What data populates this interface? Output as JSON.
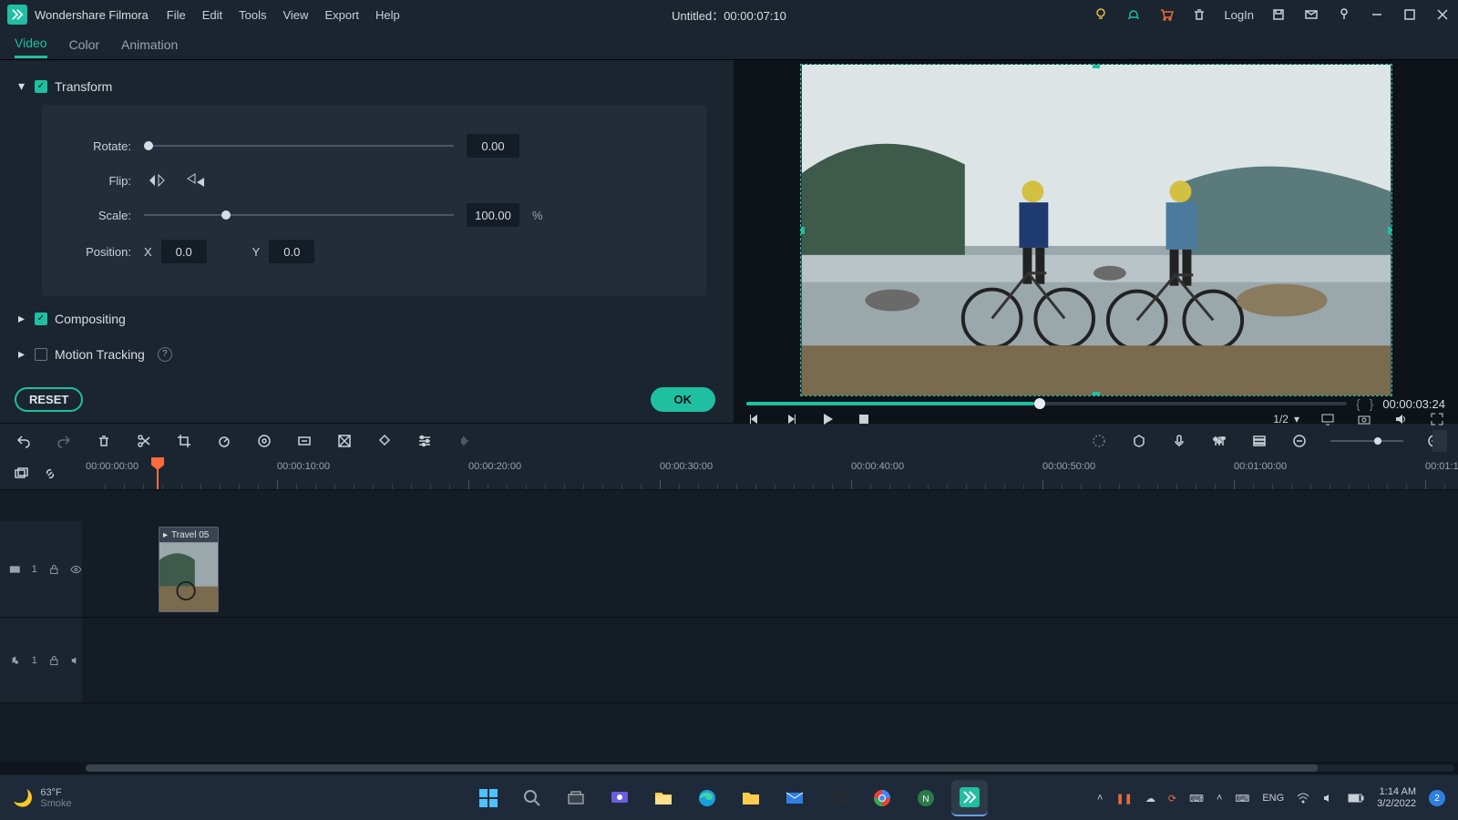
{
  "app_name": "Wondershare Filmora",
  "menu": [
    "File",
    "Edit",
    "Tools",
    "View",
    "Export",
    "Help"
  ],
  "title_center": "Untitled：00:00:07:10",
  "login_label": "LogIn",
  "tabs": [
    "Video",
    "Color",
    "Animation"
  ],
  "active_tab": "Video",
  "transform": {
    "label": "Transform",
    "rotate_label": "Rotate:",
    "rotate_value": "0.00",
    "flip_label": "Flip:",
    "scale_label": "Scale:",
    "scale_value": "100.00",
    "scale_unit": "%",
    "position_label": "Position:",
    "x_label": "X",
    "x_value": "0.0",
    "y_label": "Y",
    "y_value": "0.0"
  },
  "compositing_label": "Compositing",
  "motion_tracking_label": "Motion Tracking",
  "reset_label": "RESET",
  "ok_label": "OK",
  "preview": {
    "duration": "00:00:03:24",
    "progress_pct": 48,
    "quality": "1/2"
  },
  "timeline": {
    "start_label": "00:00:00:00",
    "ticks": [
      "00:00:10:00",
      "00:00:20:00",
      "00:00:30:00",
      "00:00:40:00",
      "00:00:50:00",
      "00:01:00:00",
      "00:01:1"
    ],
    "clip_name": "Travel 05",
    "video_track_label": "1",
    "audio_track_label": "1"
  },
  "taskbar": {
    "weather_temp": "63°F",
    "weather_desc": "Smoke",
    "lang": "ENG",
    "time": "1:14 AM",
    "date": "3/2/2022",
    "notif_count": "2"
  }
}
